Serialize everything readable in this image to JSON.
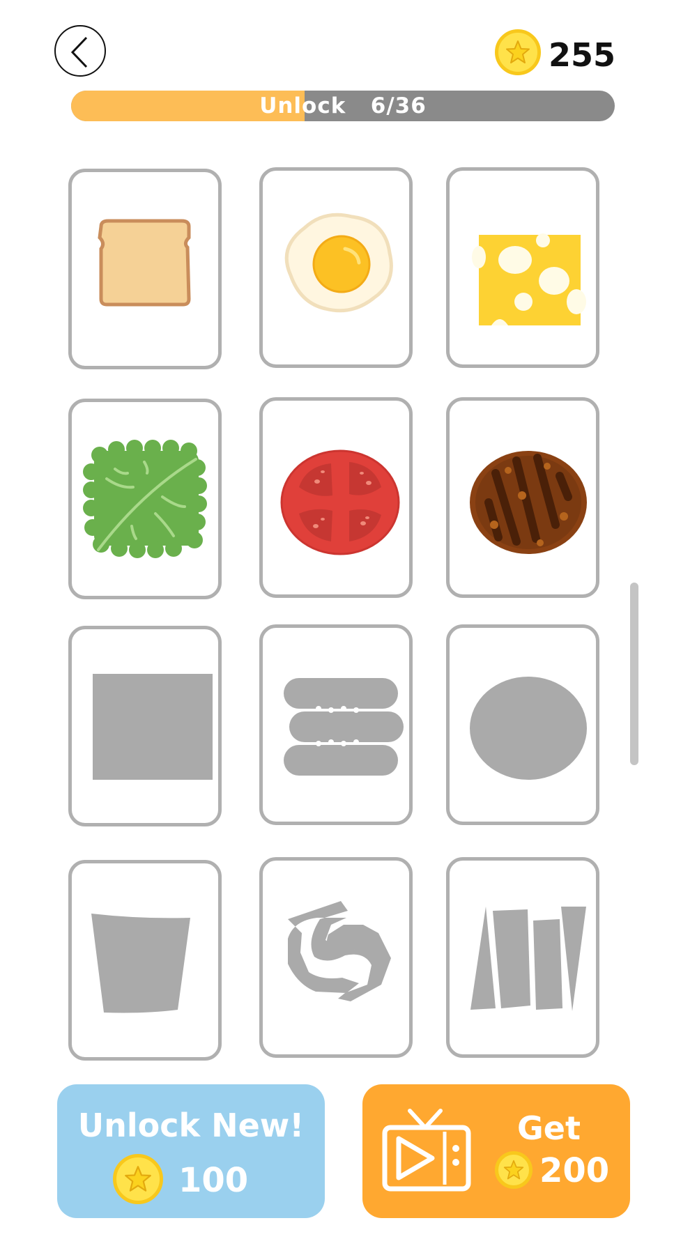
{
  "header": {
    "back_icon": "chevron-left-icon",
    "coins": "255",
    "coin_icon": "star-coin-icon"
  },
  "progress": {
    "label": "Unlock",
    "count": "6/36",
    "unlocked": 6,
    "total": 36
  },
  "items": [
    {
      "name": "bread",
      "unlocked": true
    },
    {
      "name": "fried-egg",
      "unlocked": true
    },
    {
      "name": "cheese",
      "unlocked": true
    },
    {
      "name": "lettuce",
      "unlocked": true
    },
    {
      "name": "tomato",
      "unlocked": true
    },
    {
      "name": "patty",
      "unlocked": true
    },
    {
      "name": "square-silhouette",
      "unlocked": false
    },
    {
      "name": "stacked-silhouette",
      "unlocked": false
    },
    {
      "name": "round-silhouette",
      "unlocked": false
    },
    {
      "name": "slice-silhouette",
      "unlocked": false
    },
    {
      "name": "shrimp-silhouette",
      "unlocked": false
    },
    {
      "name": "strips-silhouette",
      "unlocked": false
    }
  ],
  "buttons": {
    "unlock_label": "Unlock New!",
    "unlock_price": "100",
    "get_label": "Get",
    "get_amount": "200",
    "tv_icon": "tv-play-icon"
  },
  "colors": {
    "progress_fill": "#fdbd56",
    "progress_track": "#8a8a8a",
    "unlock_button": "#9ad0ee",
    "get_button": "#ffa830",
    "locked_silhouette": "#aaaaaa",
    "card_border": "#b0b0b0"
  }
}
